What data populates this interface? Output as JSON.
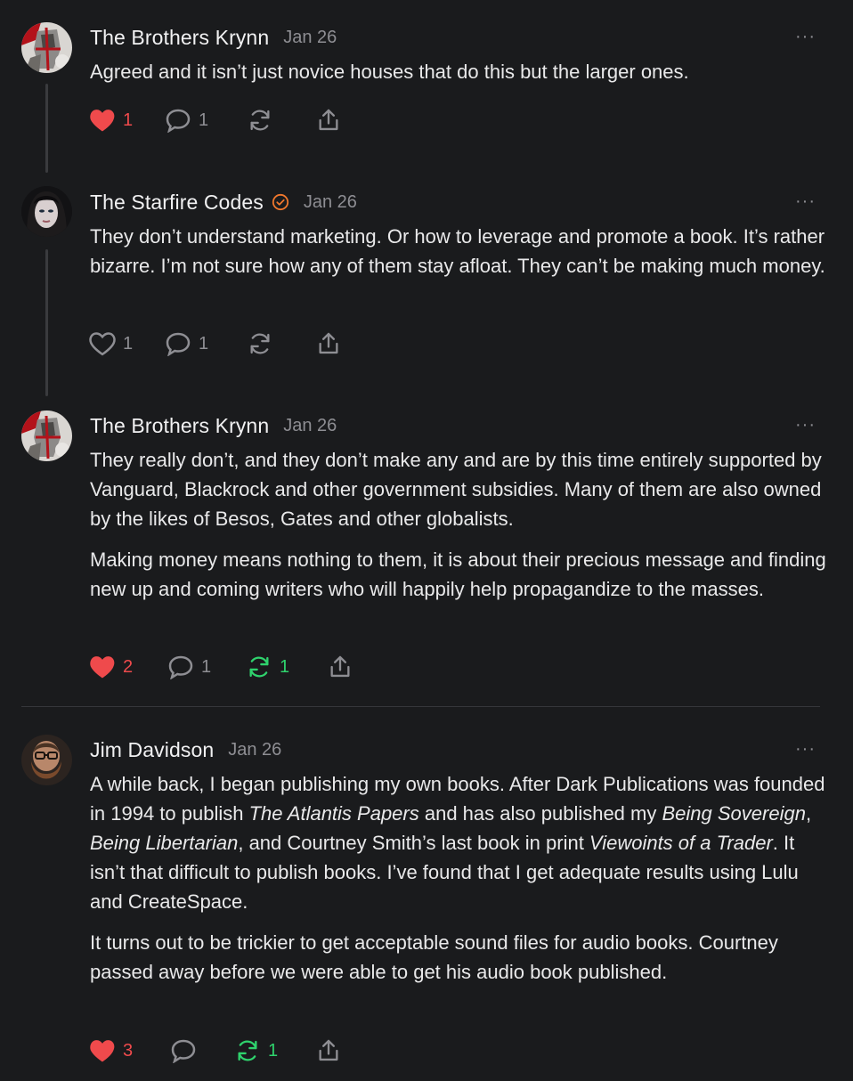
{
  "comments": [
    {
      "author": "The Brothers Krynn",
      "date": "Jan 26",
      "verified": false,
      "paragraphs": [
        "Agreed and it isn’t just novice houses that do this but the larger ones."
      ],
      "likes": "1",
      "liked": true,
      "replies": "1",
      "restacks": "",
      "restacked": false
    },
    {
      "author": "The Starfire Codes",
      "date": "Jan 26",
      "verified": true,
      "paragraphs": [
        "They don’t understand marketing. Or how to leverage and promote a book. It’s rather bizarre. I’m not sure how any of them stay afloat. They can’t be making much money."
      ],
      "likes": "1",
      "liked": false,
      "replies": "1",
      "restacks": "",
      "restacked": false
    },
    {
      "author": "The Brothers Krynn",
      "date": "Jan 26",
      "verified": false,
      "paragraphs": [
        "They really don’t, and they don’t make any and are by this time entirely supported by Vanguard, Blackrock and other government subsidies. Many of them are also owned by the likes of Besos, Gates and other globalists.",
        "Making money means nothing to them, it is about their precious message and finding new up and coming writers who will happily help propagandize to the masses."
      ],
      "likes": "2",
      "liked": true,
      "replies": "1",
      "restacks": "1",
      "restacked": true
    },
    {
      "author": "Jim Davidson",
      "date": "Jan 26",
      "verified": false,
      "paragraphs_rich": [
        [
          {
            "t": "A while back, I began publishing my own books. After Dark Publications was founded in 1994 to publish "
          },
          {
            "t": "The Atlantis Papers",
            "i": true
          },
          {
            "t": " and has also published my "
          },
          {
            "t": "Being Sovereign",
            "i": true
          },
          {
            "t": ", "
          },
          {
            "t": "Being Libertarian",
            "i": true
          },
          {
            "t": ", and Courtney Smith’s last book in print "
          },
          {
            "t": "Viewoints of a Trader",
            "i": true
          },
          {
            "t": ". It isn’t that difficult to publish books. I’ve found that I get adequate results using Lulu and CreateSpace."
          }
        ],
        [
          {
            "t": "It turns out to be trickier to get acceptable sound files for audio books. Courtney passed away before we were able to get his audio book published."
          }
        ]
      ],
      "likes": "3",
      "liked": true,
      "replies": "",
      "restacks": "1",
      "restacked": true
    }
  ],
  "more_label": "···",
  "colors": {
    "background": "#1a1b1d",
    "heart_active": "#ef4a4c",
    "restack_active": "#2fd36d",
    "verified": "#f0782d",
    "muted": "#8e8e93"
  },
  "icons": [
    "heart-icon",
    "comment-icon",
    "restack-icon",
    "share-icon",
    "more-icon",
    "verified-icon"
  ]
}
